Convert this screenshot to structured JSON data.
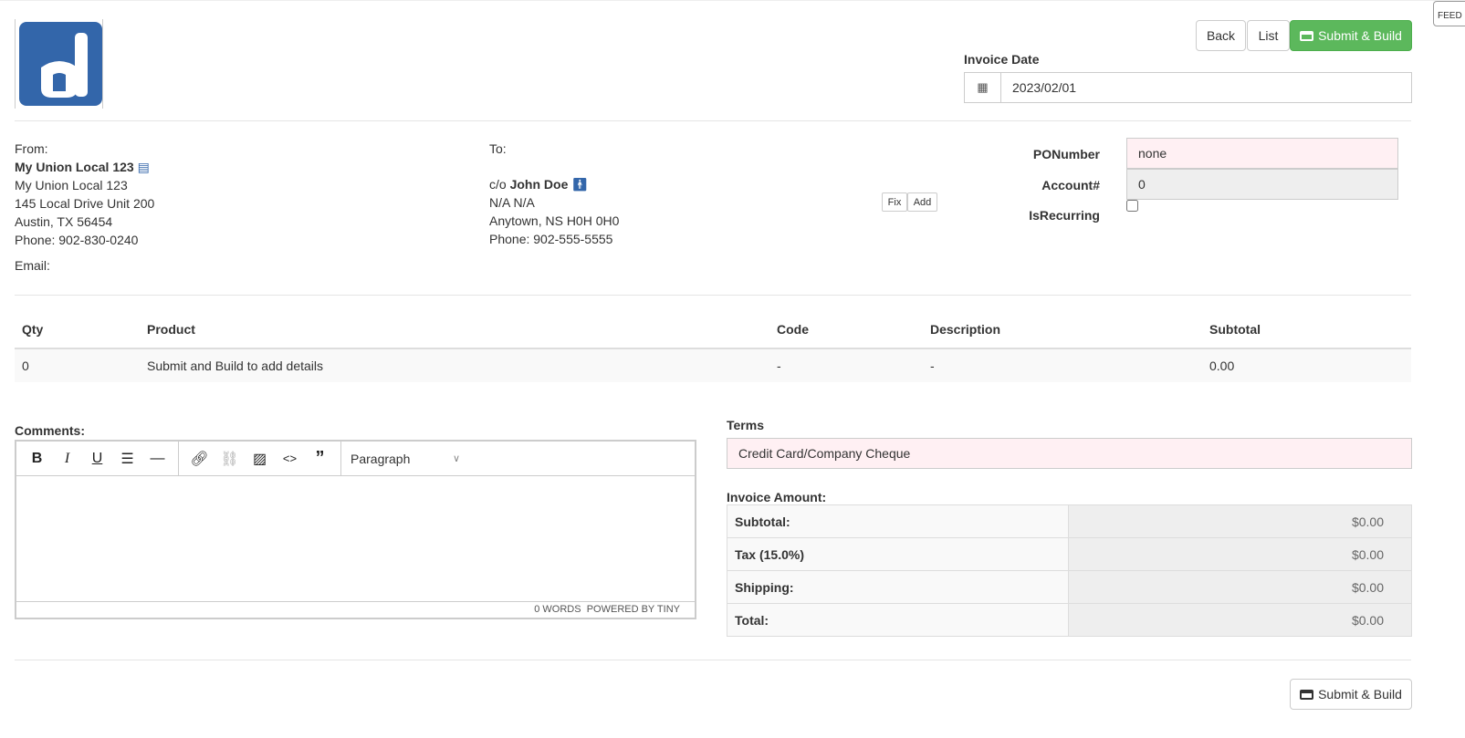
{
  "header": {
    "logo_text": "d",
    "back": "Back",
    "list": "List",
    "submit": "Submit & Build",
    "feedback": "FEED",
    "invoice_date_label": "Invoice Date",
    "invoice_date": "2023/02/01"
  },
  "from": {
    "label": "From:",
    "name": "My Union Local 123",
    "line1": "My Union Local 123",
    "line2": "145 Local Drive Unit 200",
    "line3": "Austin, TX 56454",
    "phone": "Phone: 902-830-0240",
    "email": "Email:"
  },
  "to": {
    "label": "To:",
    "co": "c/o",
    "name": "John Doe",
    "line1": "N/A N/A",
    "line2": "Anytown, NS H0H 0H0",
    "phone": "Phone: 902-555-5555",
    "fix": "Fix",
    "add": "Add"
  },
  "fields": {
    "po_label": "PONumber",
    "po_value": "none",
    "account_label": "Account#",
    "account_value": "0",
    "recurring_label": "IsRecurring",
    "recurring_checked": false
  },
  "items": {
    "headers": [
      "Qty",
      "Product",
      "Code",
      "Description",
      "Subtotal"
    ],
    "rows": [
      [
        "0",
        "Submit and Build to add details",
        "-",
        "-",
        "0.00"
      ]
    ]
  },
  "comments": {
    "label": "Comments:",
    "format": "Paragraph",
    "words": "0 WORDS",
    "powered": "POWERED BY TINY"
  },
  "terms": {
    "label": "Terms",
    "value": "Credit Card/Company Cheque"
  },
  "amount": {
    "label": "Invoice Amount:",
    "rows": [
      [
        "Subtotal:",
        "$0.00"
      ],
      [
        "Tax (15.0%)",
        "$0.00"
      ],
      [
        "Shipping:",
        "$0.00"
      ],
      [
        "Total:",
        "$0.00"
      ]
    ]
  },
  "colors": {
    "brand": "#3366aa",
    "submit": "#5cb85c",
    "required_bg": "#fff0f3"
  }
}
